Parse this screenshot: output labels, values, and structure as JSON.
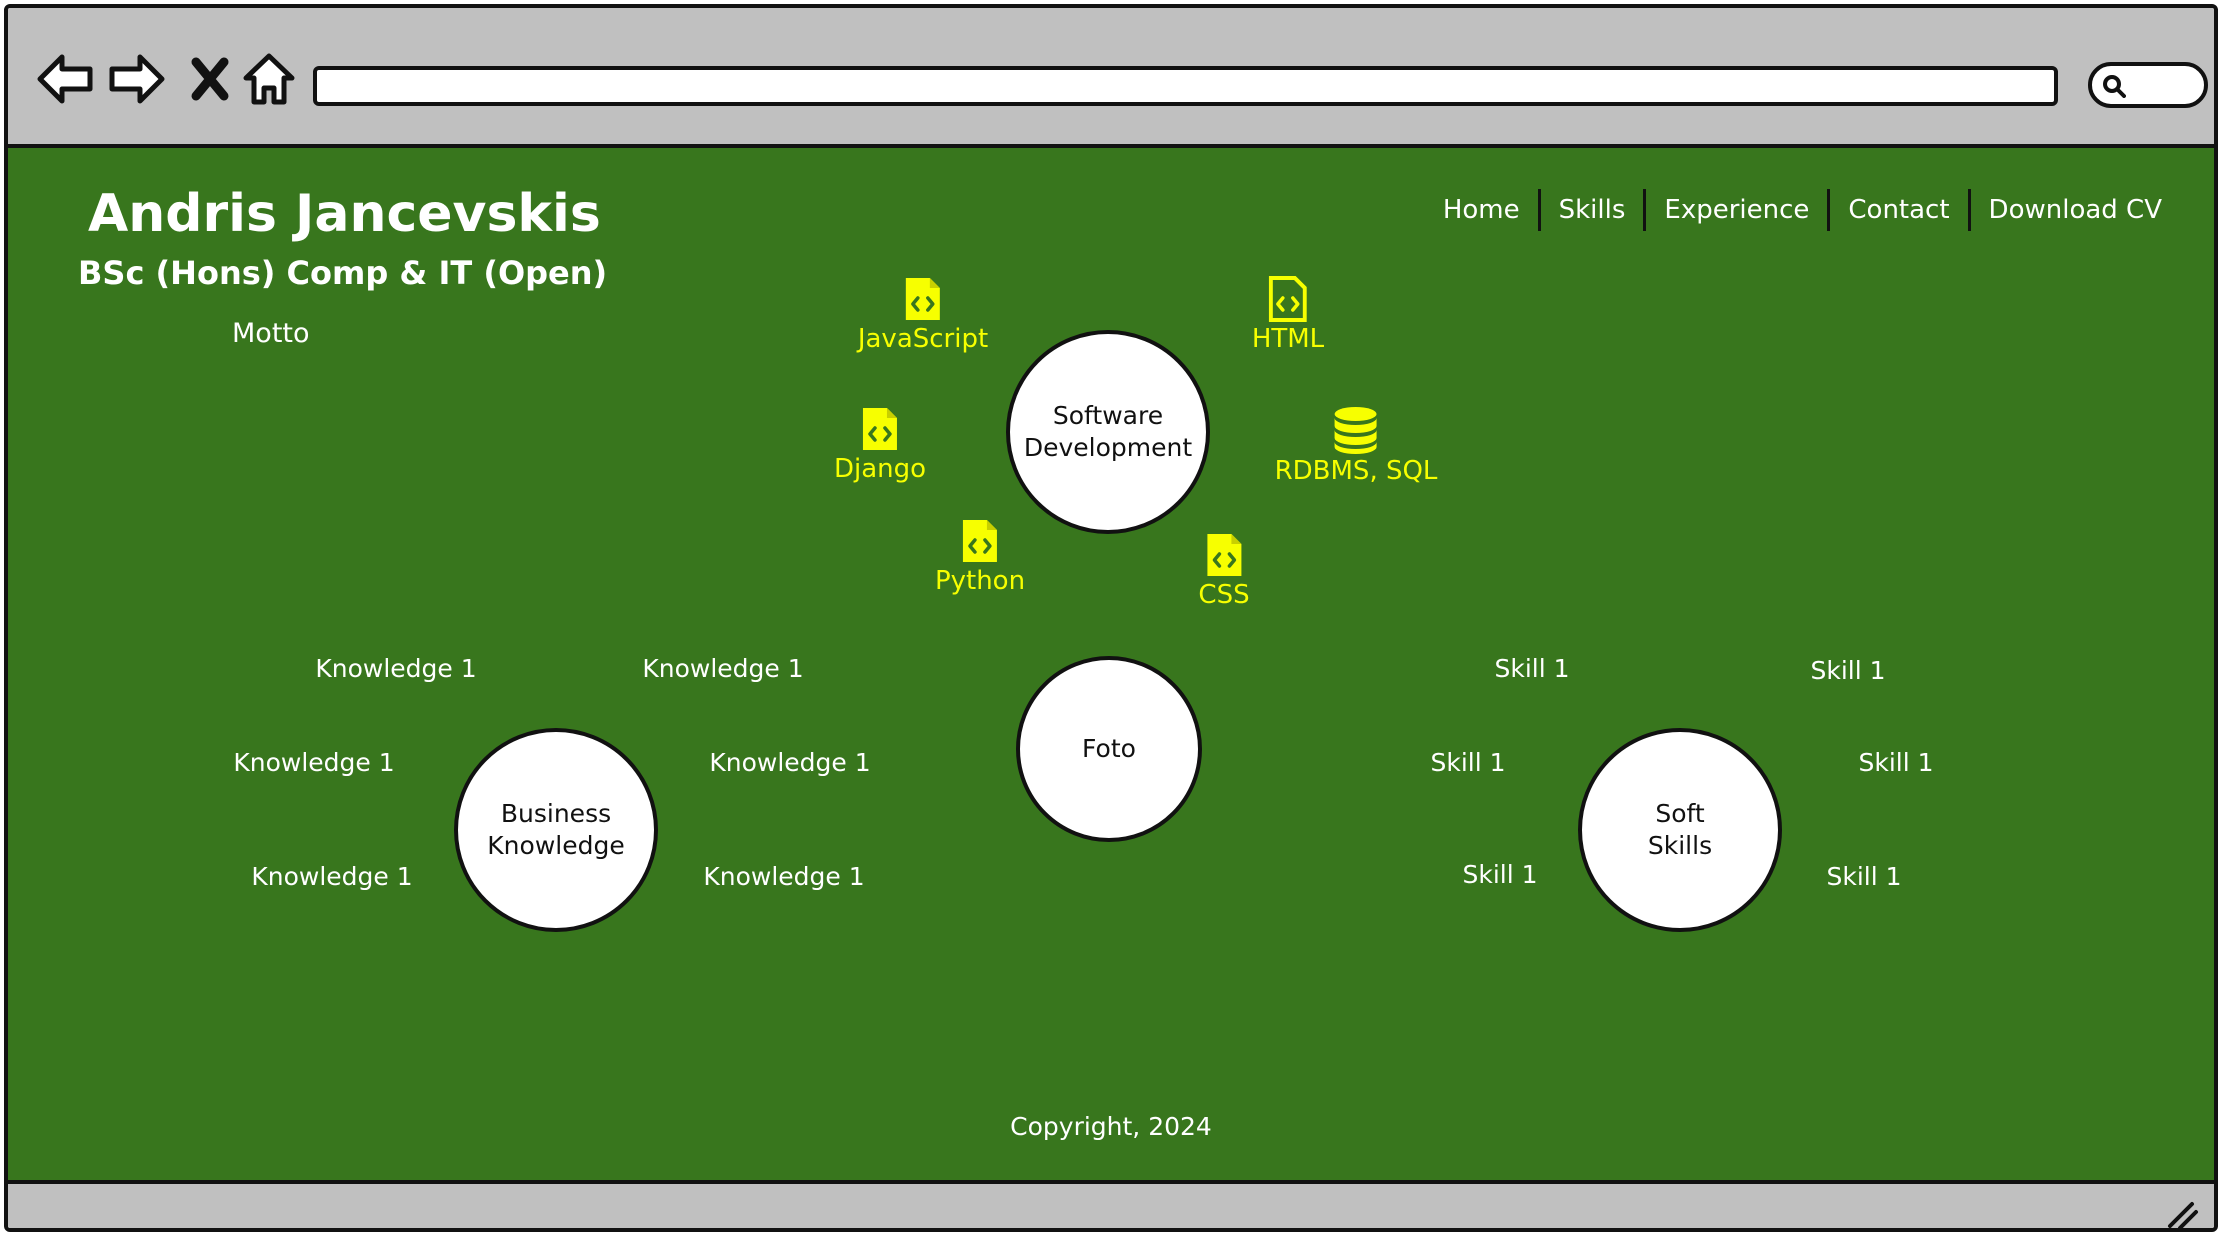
{
  "colors": {
    "content_bg": "#38761d",
    "chrome": "#c0c0c0",
    "accent": "#f7ff00",
    "text": "#ffffff",
    "outline": "#111111"
  },
  "browser": {
    "icons": [
      "back-arrow-icon",
      "forward-arrow-icon",
      "close-x-icon",
      "home-icon",
      "search-icon",
      "resize-grip-icon"
    ]
  },
  "header": {
    "name": "Andris Jancevskis",
    "degree": "BSc (Hons) Comp & IT (Open)",
    "motto": "Motto"
  },
  "nav": [
    "Home",
    "Skills",
    "Experience",
    "Contact",
    "Download CV"
  ],
  "software": {
    "title": "Software\nDevelopment",
    "techs": [
      {
        "label": "JavaScript",
        "icon": "code-file-icon"
      },
      {
        "label": "HTML",
        "icon": "code-file-icon"
      },
      {
        "label": "Django",
        "icon": "code-file-icon"
      },
      {
        "label": "RDBMS, SQL",
        "icon": "database-icon"
      },
      {
        "label": "Python",
        "icon": "code-file-icon"
      },
      {
        "label": "CSS",
        "icon": "code-file-icon"
      }
    ]
  },
  "photo": {
    "label": "Foto"
  },
  "business": {
    "title": "Business\nKnowledge",
    "items": [
      "Knowledge 1",
      "Knowledge 1",
      "Knowledge 1",
      "Knowledge 1",
      "Knowledge 1",
      "Knowledge 1"
    ]
  },
  "soft": {
    "title": "Soft\nSkills",
    "items": [
      "Skill 1",
      "Skill 1",
      "Skill 1",
      "Skill 1",
      "Skill 1",
      "Skill 1"
    ]
  },
  "footer": {
    "copyright": "Copyright, 2024"
  }
}
